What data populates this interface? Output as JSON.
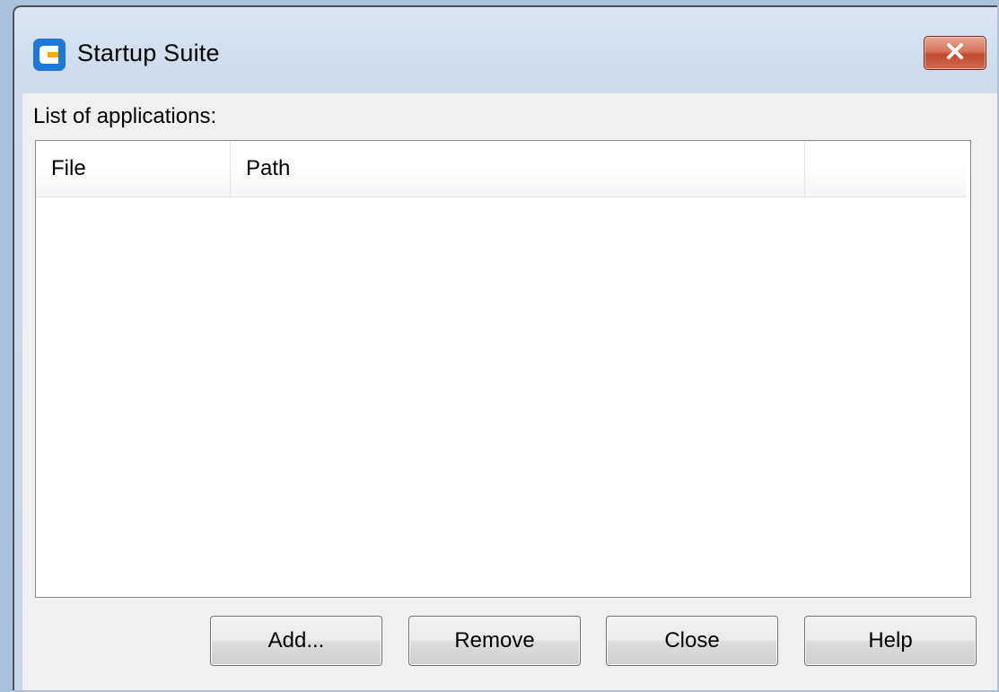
{
  "window": {
    "title": "Startup Suite",
    "close_glyph": "×",
    "icon": "app-logo-icon"
  },
  "list": {
    "label": "List of applications:",
    "columns": [
      "File",
      "Path",
      ""
    ],
    "rows": []
  },
  "buttons": {
    "add": "Add...",
    "remove": "Remove",
    "close": "Close",
    "help": "Help"
  },
  "colors": {
    "close_button": "#c44b2f",
    "logo_primary": "#1e78d6",
    "logo_accent": "#f2a900"
  }
}
